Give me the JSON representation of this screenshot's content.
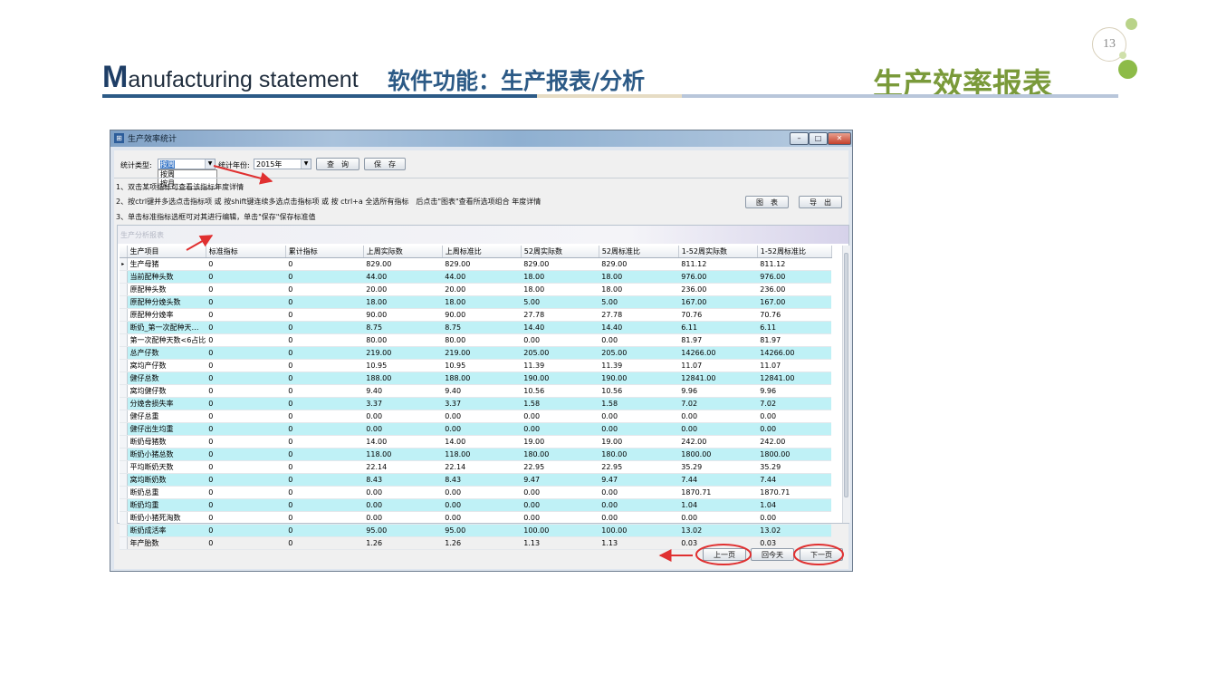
{
  "slide": {
    "header_en_first": "M",
    "header_en_rest": "anufacturing statement",
    "header_cn": "软件功能：生产报表/分析",
    "header_right": "生产效率报表",
    "page_number": "13"
  },
  "window": {
    "title": "生产效率统计",
    "icon_glyph": "⊞",
    "controls": {
      "minimize": "–",
      "maximize": "□",
      "close": "✕"
    }
  },
  "filters": {
    "type_label": "统计类型:",
    "type_value": "按周",
    "type_options": [
      "按周",
      "按月"
    ],
    "year_label": "统计年份:",
    "year_value": "2015年",
    "query_button": "查　询",
    "save_button": "保　存"
  },
  "hints": [
    "1、双击某项指标可查看该指标年度详情",
    "2、按ctrl键并多选点击指标项 或 按shift键连续多选点击指标项 或 按 ctrl+a 全选所有指标　后点击\"图表\"查看所选项组合 年度详情",
    "3、单击标准指标选框可对其进行编辑，单击\"保存\"保存标准值"
  ],
  "actions": {
    "chart_button": "图　表",
    "export_button": "导　出"
  },
  "report_title": "生产分析报表",
  "table": {
    "columns": [
      "生产项目",
      "标准指标",
      "累计指标",
      "上周实际数",
      "上周标准比",
      "52周实际数",
      "52周标准比",
      "1-52周实际数",
      "1-52周标准比"
    ],
    "rows": [
      [
        "生产母猪",
        "0",
        "0",
        "829.00",
        "829.00",
        "829.00",
        "829.00",
        "811.12",
        "811.12"
      ],
      [
        "当前配种头数",
        "0",
        "0",
        "44.00",
        "44.00",
        "18.00",
        "18.00",
        "976.00",
        "976.00"
      ],
      [
        "原配种头数",
        "0",
        "0",
        "20.00",
        "20.00",
        "18.00",
        "18.00",
        "236.00",
        "236.00"
      ],
      [
        "原配种分娩头数",
        "0",
        "0",
        "18.00",
        "18.00",
        "5.00",
        "5.00",
        "167.00",
        "167.00"
      ],
      [
        "原配种分娩率",
        "0",
        "0",
        "90.00",
        "90.00",
        "27.78",
        "27.78",
        "70.76",
        "70.76"
      ],
      [
        "断奶_第一次配种天…",
        "0",
        "0",
        "8.75",
        "8.75",
        "14.40",
        "14.40",
        "6.11",
        "6.11"
      ],
      [
        "第一次配种天数<6占比",
        "0",
        "0",
        "80.00",
        "80.00",
        "0.00",
        "0.00",
        "81.97",
        "81.97"
      ],
      [
        "总产仔数",
        "0",
        "0",
        "219.00",
        "219.00",
        "205.00",
        "205.00",
        "14266.00",
        "14266.00"
      ],
      [
        "窝均产仔数",
        "0",
        "0",
        "10.95",
        "10.95",
        "11.39",
        "11.39",
        "11.07",
        "11.07"
      ],
      [
        "健仔总数",
        "0",
        "0",
        "188.00",
        "188.00",
        "190.00",
        "190.00",
        "12841.00",
        "12841.00"
      ],
      [
        "窝均健仔数",
        "0",
        "0",
        "9.40",
        "9.40",
        "10.56",
        "10.56",
        "9.96",
        "9.96"
      ],
      [
        "分娩舍损失率",
        "0",
        "0",
        "3.37",
        "3.37",
        "1.58",
        "1.58",
        "7.02",
        "7.02"
      ],
      [
        "健仔总重",
        "0",
        "0",
        "0.00",
        "0.00",
        "0.00",
        "0.00",
        "0.00",
        "0.00"
      ],
      [
        "健仔出生均重",
        "0",
        "0",
        "0.00",
        "0.00",
        "0.00",
        "0.00",
        "0.00",
        "0.00"
      ],
      [
        "断奶母猪数",
        "0",
        "0",
        "14.00",
        "14.00",
        "19.00",
        "19.00",
        "242.00",
        "242.00"
      ],
      [
        "断奶小猪总数",
        "0",
        "0",
        "118.00",
        "118.00",
        "180.00",
        "180.00",
        "1800.00",
        "1800.00"
      ],
      [
        "平均断奶天数",
        "0",
        "0",
        "22.14",
        "22.14",
        "22.95",
        "22.95",
        "35.29",
        "35.29"
      ],
      [
        "窝均断奶数",
        "0",
        "0",
        "8.43",
        "8.43",
        "9.47",
        "9.47",
        "7.44",
        "7.44"
      ],
      [
        "断奶总重",
        "0",
        "0",
        "0.00",
        "0.00",
        "0.00",
        "0.00",
        "1870.71",
        "1870.71"
      ],
      [
        "断奶均重",
        "0",
        "0",
        "0.00",
        "0.00",
        "0.00",
        "0.00",
        "1.04",
        "1.04"
      ],
      [
        "断奶小猪死淘数",
        "0",
        "0",
        "0.00",
        "0.00",
        "0.00",
        "0.00",
        "0.00",
        "0.00"
      ],
      [
        "断奶成活率",
        "0",
        "0",
        "95.00",
        "95.00",
        "100.00",
        "100.00",
        "13.02",
        "13.02"
      ],
      [
        "年产胎数",
        "0",
        "0",
        "1.26",
        "1.26",
        "1.13",
        "1.13",
        "0.03",
        "0.03"
      ]
    ]
  },
  "pager": {
    "prev": "上一页",
    "today": "回今天",
    "next": "下一页"
  },
  "colors": {
    "annotation_red": "#e03030",
    "row_highlight": "#bff1f6",
    "header_blue": "#2c5a86",
    "accent_green": "#7a9a3a"
  }
}
